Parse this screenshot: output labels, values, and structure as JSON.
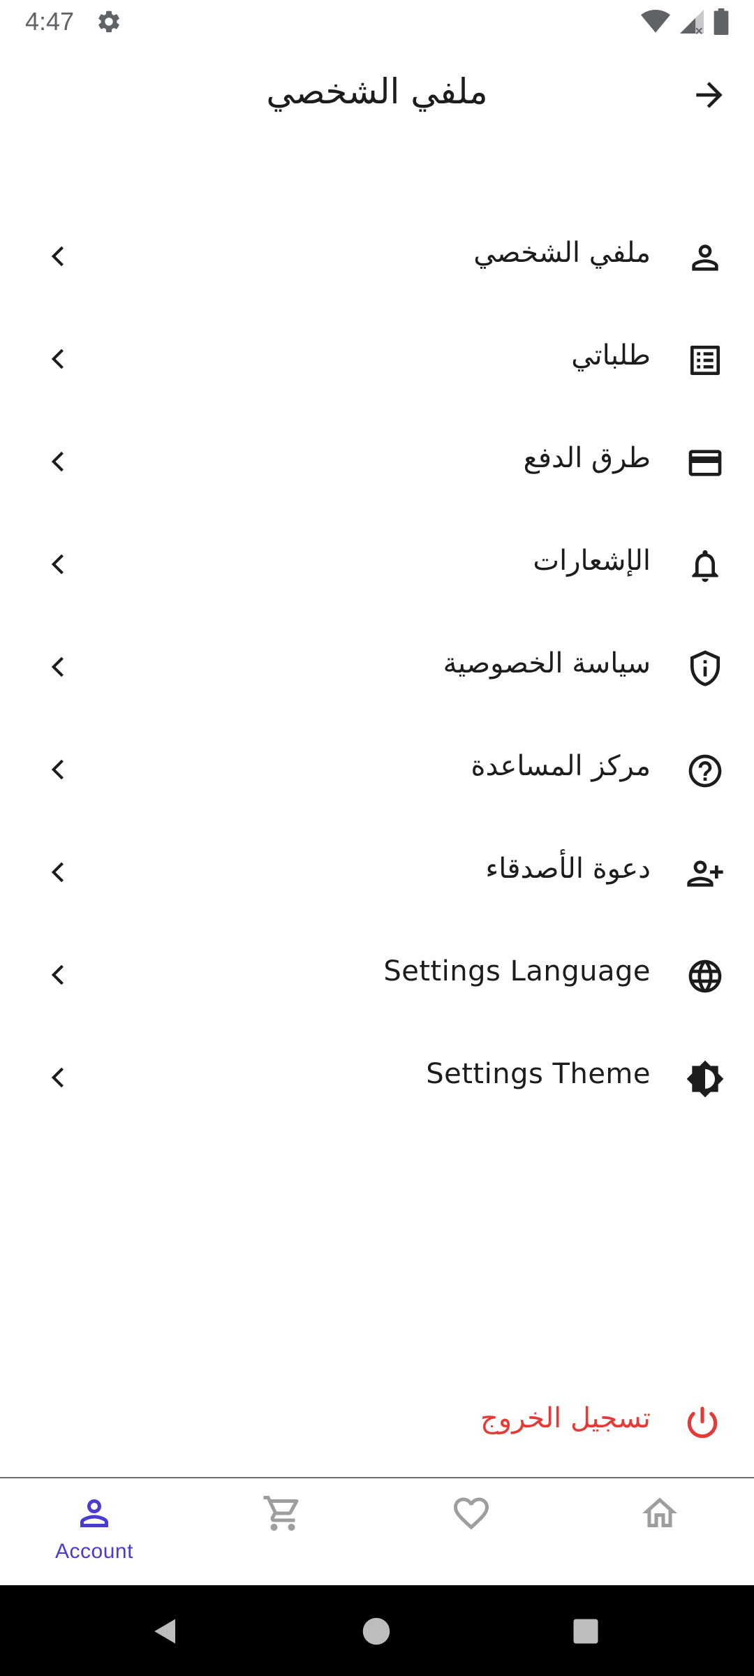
{
  "status_bar": {
    "time": "4:47",
    "icons": [
      "settings-icon",
      "wifi-icon",
      "signal-icon",
      "battery-icon"
    ]
  },
  "header": {
    "title": "ملفي الشخصي",
    "back_icon": "arrow-forward-icon"
  },
  "menu": {
    "items": [
      {
        "label": "ملفي الشخصي",
        "icon": "person-icon"
      },
      {
        "label": "طلباتي",
        "icon": "receipt-list-icon"
      },
      {
        "label": "طرق الدفع",
        "icon": "credit-card-icon"
      },
      {
        "label": "الإشعارات",
        "icon": "bell-icon"
      },
      {
        "label": "سياسة الخصوصية",
        "icon": "shield-info-icon"
      },
      {
        "label": "مركز المساعدة",
        "icon": "help-circle-icon"
      },
      {
        "label": "دعوة الأصدقاء",
        "icon": "person-add-icon"
      },
      {
        "label": "Settings Language",
        "icon": "globe-icon"
      },
      {
        "label": "Settings Theme",
        "icon": "brightness-icon"
      }
    ],
    "chevron_icon": "chevron-left-icon"
  },
  "logout": {
    "label": "تسجيل الخروج",
    "icon": "power-icon",
    "color": "#e53935"
  },
  "bottom_nav": {
    "active_color": "#4a3ad6",
    "inactive_color": "#9e9e9e",
    "items": [
      {
        "label": "Account",
        "icon": "account-icon",
        "active": true
      },
      {
        "label": "",
        "icon": "cart-icon",
        "active": false
      },
      {
        "label": "",
        "icon": "heart-icon",
        "active": false
      },
      {
        "label": "",
        "icon": "home-icon",
        "active": false
      }
    ]
  }
}
